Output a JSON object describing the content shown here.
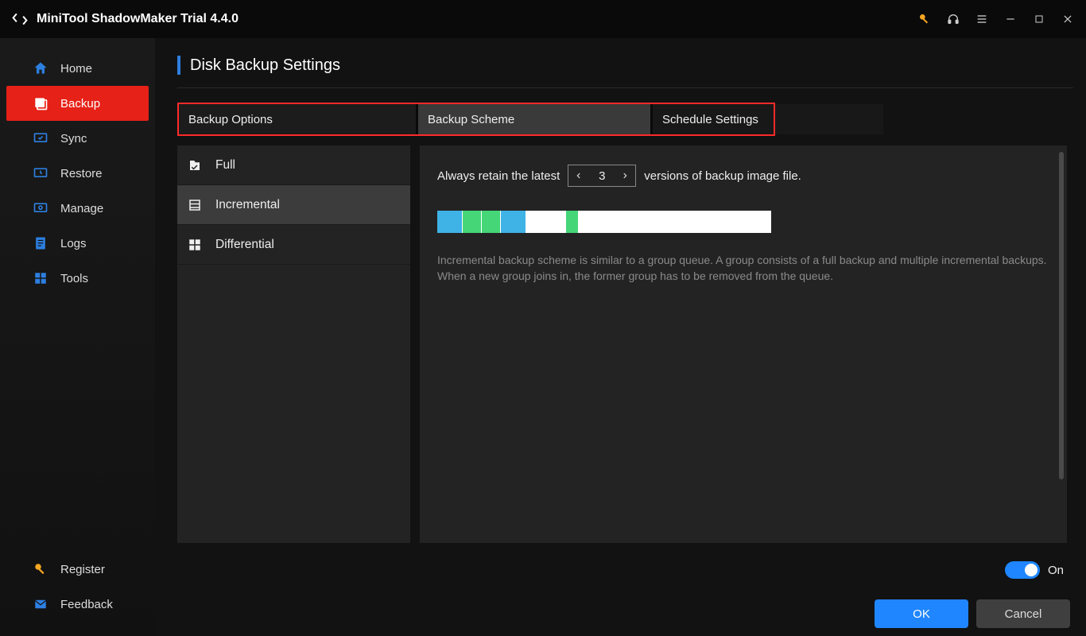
{
  "app_title": "MiniTool ShadowMaker Trial 4.4.0",
  "sidebar": {
    "items": [
      {
        "label": "Home"
      },
      {
        "label": "Backup"
      },
      {
        "label": "Sync"
      },
      {
        "label": "Restore"
      },
      {
        "label": "Manage"
      },
      {
        "label": "Logs"
      },
      {
        "label": "Tools"
      }
    ],
    "register": "Register",
    "feedback": "Feedback"
  },
  "page_title": "Disk Backup Settings",
  "tabs": {
    "options": "Backup Options",
    "scheme": "Backup Scheme",
    "schedule": "Schedule Settings"
  },
  "scheme_types": {
    "full": "Full",
    "incremental": "Incremental",
    "differential": "Differential"
  },
  "detail": {
    "retain_prefix": "Always retain the latest",
    "retain_value": "3",
    "retain_suffix": "versions of backup image file.",
    "description": "Incremental backup scheme is similar to a group queue. A group consists of a full backup and multiple incremental backups. When a new group joins in, the former group has to be removed from the queue."
  },
  "footer": {
    "on_label": "On",
    "ok": "OK",
    "cancel": "Cancel"
  },
  "colors": {
    "accent": "#e62117",
    "blue": "#1f86ff",
    "block_blue": "#3fb2e6",
    "block_green": "#45d678"
  }
}
